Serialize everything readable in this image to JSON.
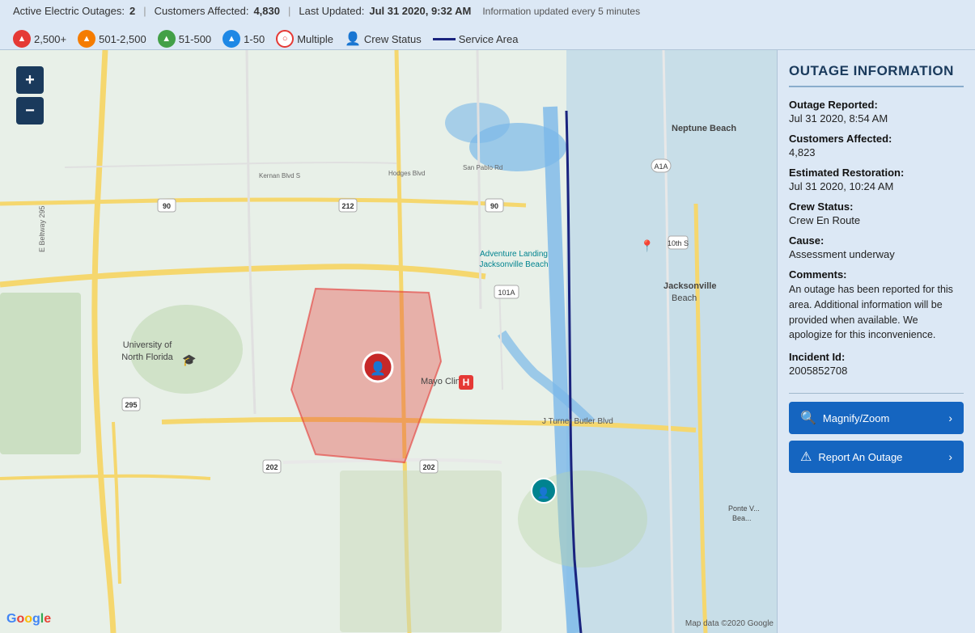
{
  "topbar": {
    "active_outages_label": "Active Electric Outages:",
    "active_outages_value": "2",
    "customers_affected_label": "Customers Affected:",
    "customers_affected_value": "4,830",
    "last_updated_label": "Last Updated:",
    "last_updated_value": "Jul 31 2020, 9:32 AM",
    "update_note": "Information updated every 5 minutes",
    "legend": [
      {
        "id": "2500plus",
        "label": "2,500+",
        "type": "circle-red"
      },
      {
        "id": "501-2500",
        "label": "501-2,500",
        "type": "circle-orange"
      },
      {
        "id": "51-500",
        "label": "51-500",
        "type": "circle-green"
      },
      {
        "id": "1-50",
        "label": "1-50",
        "type": "circle-blue"
      },
      {
        "id": "multiple",
        "label": "Multiple",
        "type": "circle-multi"
      },
      {
        "id": "crew",
        "label": "Crew Status",
        "type": "crew"
      },
      {
        "id": "service",
        "label": "Service Area",
        "type": "line"
      }
    ]
  },
  "panel": {
    "title": "OUTAGE INFORMATION",
    "outage_reported_label": "Outage Reported:",
    "outage_reported_value": "Jul 31 2020, 8:54 AM",
    "customers_affected_label": "Customers Affected:",
    "customers_affected_value": "4,823",
    "estimated_restoration_label": "Estimated Restoration:",
    "estimated_restoration_value": "Jul 31 2020, 10:24 AM",
    "crew_status_label": "Crew Status:",
    "crew_status_value": "Crew En Route",
    "cause_label": "Cause:",
    "cause_value": "Assessment underway",
    "comments_label": "Comments:",
    "comments_value": "An outage has been reported for this area. Additional information will be provided when available. We apologize for this inconvenience.",
    "incident_id_label": "Incident Id:",
    "incident_id_value": "2005852708",
    "magnify_zoom_btn": "Magnify/Zoom",
    "report_outage_btn": "Report An Outage"
  },
  "map": {
    "locations": {
      "neptune_beach": "Neptune Beach",
      "jacksonville_beach": "Jacksonville Beach",
      "adventure_landing": "Adventure Landing Jacksonville Beach",
      "university_nf": "University of North Florida",
      "mayo_clinic": "Mayo Clinic",
      "ponte_beach": "Ponte V... Bea..."
    },
    "credit": "Map data ©2020 Google",
    "zoom_in": "+",
    "zoom_out": "−"
  }
}
